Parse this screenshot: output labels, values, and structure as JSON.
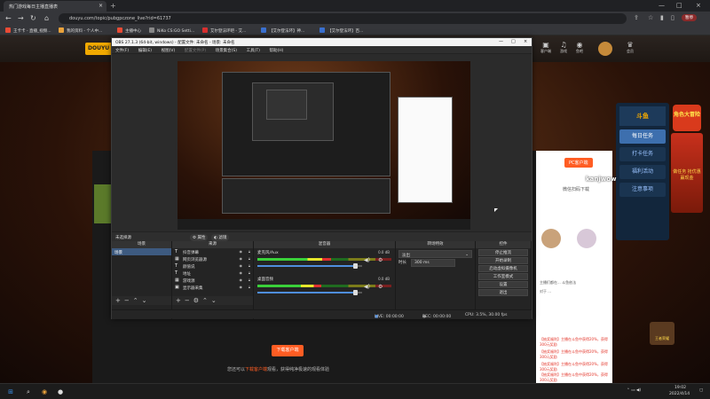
{
  "browser": {
    "tab_title": "热门游戏每日主播直播表",
    "url": "douyu.com/topic/pubgpczone_live?rid=61737",
    "paused_label": "暂停",
    "bookmarks": [
      {
        "label": "王卡卡 - 直播_视频...",
        "color": "#e94b35"
      },
      {
        "label": "我的资料 - 个人中...",
        "color": "#e9a23b"
      },
      {
        "label": "主播中心",
        "color": "#e94b35"
      },
      {
        "label": "NiKo CS:GO Setti...",
        "color": "#888888"
      },
      {
        "label": "艾尔登法环吧 - 艾...",
        "color": "#d93030"
      },
      {
        "label": "【艾尔登法环】神...",
        "color": "#3a70d0"
      },
      {
        "label": "【艾尔登法环】百...",
        "color": "#3a70d0"
      }
    ]
  },
  "site": {
    "header_icons": [
      {
        "label": "客户端",
        "glyph": "▣"
      },
      {
        "label": "游戏",
        "glyph": "♫"
      },
      {
        "label": "鱼吧",
        "glyph": "◉"
      },
      {
        "label": "会员",
        "glyph": "♛"
      }
    ],
    "side_panel": {
      "logo": "斗鱼",
      "items": [
        "每日任务",
        "打卡任务",
        "福利活动",
        "注意事项"
      ],
      "active_index": 0
    },
    "promo_top": "角色大冒险",
    "promo_right": "做任务 抢优惠 赢现金",
    "promo_bottom": "王者荣耀",
    "chat_overlay_user": "kanjwow",
    "right_col": {
      "btn": "PC客户端",
      "title": "微信扫码下载",
      "texts": [
        "主播们都在... 斗鱼依法",
        "对于 ...",
        "【抽奖福利】主播在斗鱼中获得20%，获得300元奖励",
        "【抽奖福利】主播在斗鱼中获得20%，获得300元奖励",
        "【抽奖福利】主播在斗鱼中获得20%，获得300元奖励",
        "【抽奖福利】主播在斗鱼中获得20%，获得300元奖励"
      ]
    },
    "download_btn": "下载客户端",
    "download_text_prefix": "您还可以",
    "download_text_highlight": "下载客户端",
    "download_text_suffix": "观看，获得纯净极速的观看体验"
  },
  "obs": {
    "title": "OBS 27.1.3 (64-bit, windows) - 配置文件: 未命名 - 场景: 未命名",
    "menu": [
      "文件(F)",
      "编辑(E)",
      "视图(V)",
      "配置文件(P)",
      "场景集合(S)",
      "工具(T)",
      "帮助(H)"
    ],
    "menu_dim_index": 3,
    "no_source_label": "未选择源",
    "props_btn": "属性",
    "filters_btn": "滤镜",
    "docks": {
      "scenes": "场景",
      "sources": "来源",
      "mixer": "混音器",
      "transitions": "转场特效",
      "controls": "控件"
    },
    "scenes": [
      "场景"
    ],
    "sources": [
      {
        "icon": "T",
        "label": "抖音弹幕"
      },
      {
        "icon": "▦",
        "label": "网页浏览器源"
      },
      {
        "icon": "T",
        "label": "颜值说"
      },
      {
        "icon": "T",
        "label": "地址"
      },
      {
        "icon": "▦",
        "label": "游戏源"
      },
      {
        "icon": "▣",
        "label": "显示器采集"
      }
    ],
    "mixer": [
      {
        "name": "麦克风/Aux",
        "db": "0.0 dB",
        "level": 0.55,
        "volume": 0.93
      },
      {
        "name": "桌面音频",
        "db": "0.0 dB",
        "level": 0.48,
        "volume": 0.93
      }
    ],
    "transition": {
      "type": "淡出",
      "duration_label": "时长",
      "duration": "300 ms"
    },
    "controls": [
      "停止推流",
      "开始录制",
      "启动虚拟摄像机",
      "工作室模式",
      "设置",
      "退出"
    ],
    "status": {
      "live": "LIVE: 00:00:00",
      "rec": "REC: 00:00:00",
      "cpu": "CPU: 3.5%, 30.00 fps"
    }
  },
  "taskbar": {
    "time": "19:02",
    "date": "2022/4/14",
    "apps": [
      {
        "name": "windows-start",
        "glyph": "⊞",
        "color": "#3a8ee6"
      },
      {
        "name": "search",
        "glyph": "⌕",
        "color": "#dddddd"
      },
      {
        "name": "chrome",
        "glyph": "◉",
        "color": "#e9a23b"
      },
      {
        "name": "obs",
        "glyph": "●",
        "color": "#dddddd"
      }
    ]
  }
}
